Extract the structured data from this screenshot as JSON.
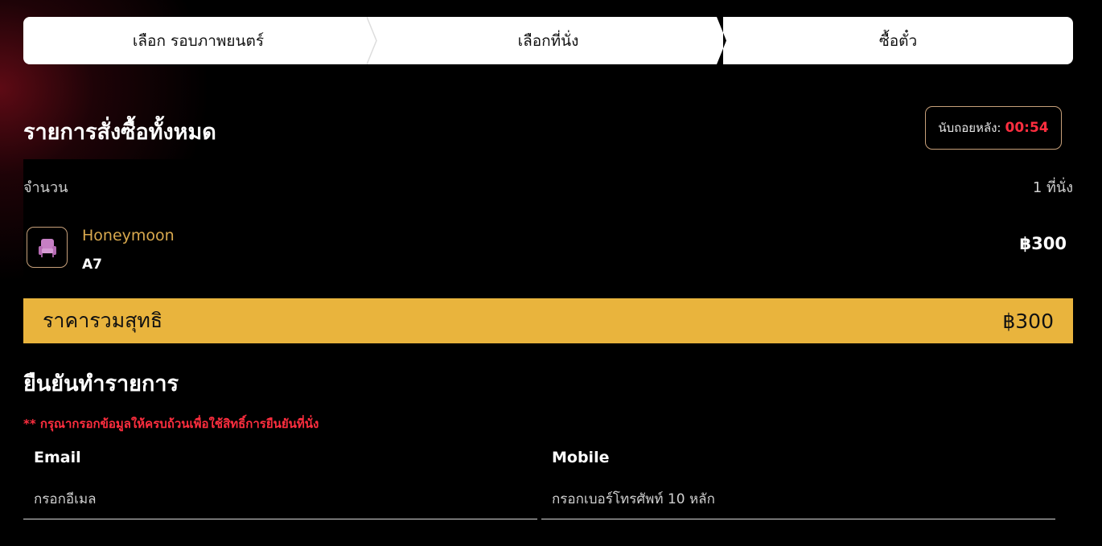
{
  "stepper": {
    "steps": [
      {
        "label": "เลือก รอบภาพยนตร์"
      },
      {
        "label": "เลือกที่นั่ง"
      },
      {
        "label": "ซื้อตั๋ว"
      }
    ]
  },
  "summary": {
    "title": "รายการสั่งซื้อทั้งหมด",
    "countdown_label": "นับถอยหลัง:",
    "countdown_time": "00:54",
    "quantity_label": "จำนวน",
    "quantity_value": "1 ที่นั่ง",
    "seat": {
      "type": "Honeymoon",
      "code": "A7",
      "price": "฿300",
      "icon": "seat-icon"
    }
  },
  "total": {
    "label": "ราคารวมสุทธิ",
    "value": "฿300"
  },
  "confirm": {
    "title": "ยืนยันทำรายการ",
    "warning": "** กรุณากรอกข้อมูลให้ครบถ้วนเพื่อใช้สิทธิ์การยืนยันที่นั่ง",
    "email_label": "Email",
    "email_placeholder": "กรอกอีเมล",
    "mobile_label": "Mobile",
    "mobile_placeholder": "กรอกเบอร์โทรศัพท์ 10 หลัก"
  },
  "colors": {
    "accent": "#e9b43d",
    "alert": "#ff2e3f",
    "seat_type": "#d9a94e",
    "border": "#c7a07a"
  }
}
